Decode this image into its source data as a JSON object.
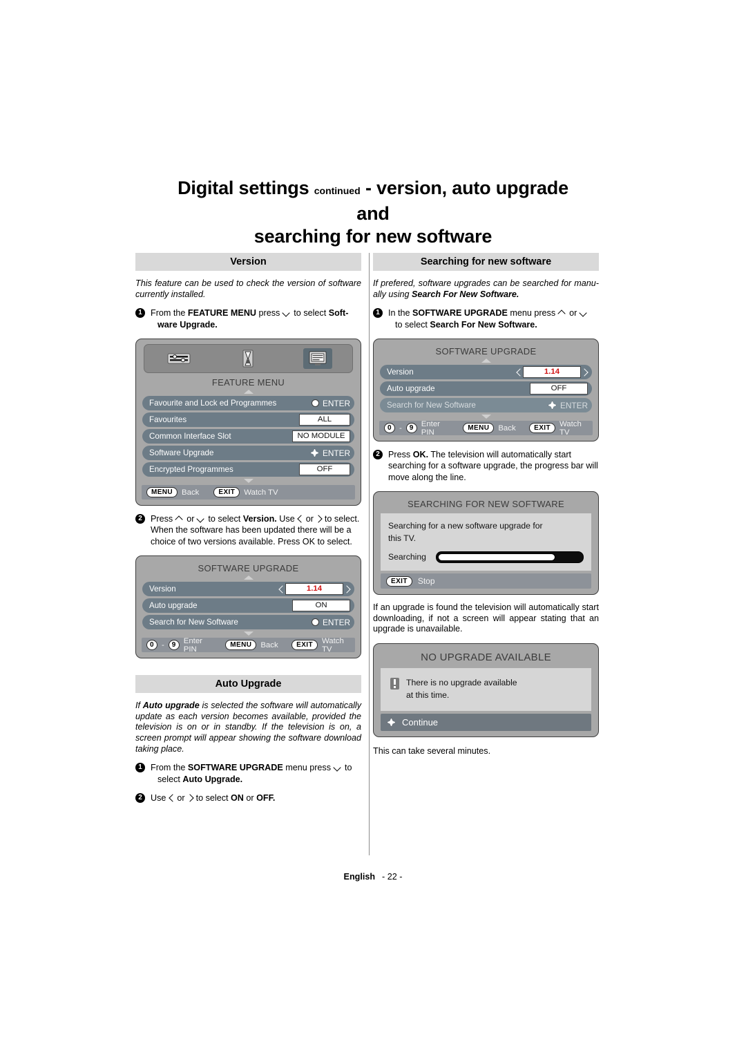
{
  "title": {
    "main_part1": "Digital settings",
    "continued": "continued",
    "main_part2": "- version, auto upgrade and",
    "line2": "searching for new software"
  },
  "left_column": {
    "version_section": {
      "heading": "Version",
      "intro": "This feature can be used to check the version of software currently installed.",
      "step1": {
        "number": "1",
        "text_a": "From the ",
        "bold_a": "FEATURE MENU",
        "text_b": " press ",
        "arrow": "down-arrow",
        "text_c": " to select ",
        "bold_b": "Soft-",
        "line2": "ware Upgrade."
      },
      "feature_menu_screen": {
        "title": "FEATURE MENU",
        "icons": [
          "settings-sliders-icon",
          "hourglass-icon",
          "tv-screen-icon"
        ],
        "selected_icon_index": 2,
        "rows": [
          {
            "label": "Favourite and Lock  ed Programmes",
            "value": "ENTER",
            "type": "enter"
          },
          {
            "label": "Favourites",
            "value": "ALL",
            "type": "value"
          },
          {
            "label": "Common Interface Slot",
            "value": "NO MODULE",
            "type": "value"
          },
          {
            "label": "Software Upgrade",
            "value": "ENTER",
            "type": "enter",
            "selected": true
          },
          {
            "label": "Encrypted Programmes",
            "value": "OFF",
            "type": "value"
          }
        ],
        "bottom_bar": [
          {
            "key": "MENU",
            "label": "Back"
          },
          {
            "key": "EXIT",
            "label": "Watch TV"
          }
        ]
      },
      "step2": {
        "number": "2",
        "text_a": "Press ",
        "text_b": " or ",
        "text_c": " to select ",
        "bold_a": "Version.",
        "text_d": " Use ",
        "text_e": " or ",
        "text_f": " to select. When the software has been updated there will be a choice of two versions available. Press OK to select."
      },
      "software_upgrade_screen": {
        "title": "SOFTWARE UPGRADE",
        "rows": [
          {
            "label": "Version",
            "value": "1.14",
            "type": "spinner"
          },
          {
            "label": "Auto upgrade",
            "value": "ON",
            "type": "value"
          },
          {
            "label": "Search for New Software",
            "value": "ENTER",
            "type": "enter"
          }
        ],
        "bottom_bar": [
          {
            "key": "0",
            "key2": "9",
            "label": "Enter PIN"
          },
          {
            "key": "MENU",
            "label": "Back"
          },
          {
            "key": "EXIT",
            "label": "Watch TV"
          }
        ]
      }
    },
    "auto_upgrade_section": {
      "heading": "Auto Upgrade",
      "intro_bold": "Auto upgrade",
      "intro_a": "If ",
      "intro_b": " is selected the software will automatically update as each version becomes available, provided the television is on or in standby.  If the television is on, a screen prompt will appear showing the software download taking place.",
      "step1": {
        "number": "1",
        "text_a": "From the ",
        "bold_a": "SOFTWARE UPGRADE",
        "text_b": " menu press ",
        "text_c": " to",
        "line2_a": "select ",
        "line2_bold": "Auto Upgrade."
      },
      "step2": {
        "number": "2",
        "text_a": "Use ",
        "text_b": " or ",
        "text_c": " to select ",
        "bold_a": "ON",
        "text_d": " or ",
        "bold_b": "OFF."
      }
    }
  },
  "right_column": {
    "searching_section": {
      "heading": "Searching for new software",
      "intro_a": "If prefered, software upgrades can be searched for manu-ally using ",
      "intro_bold": "Search For New Software.",
      "step1": {
        "number": "1",
        "text_a": "In the ",
        "bold_a": "SOFTWARE UPGRADE",
        "text_b": " menu press ",
        "text_c": " or ",
        "line2_a": "to select ",
        "line2_bold": "Search For New Software."
      },
      "software_upgrade_screen": {
        "title": "SOFTWARE UPGRADE",
        "rows": [
          {
            "label": "Version",
            "value": "1.14",
            "type": "spinner"
          },
          {
            "label": "Auto upgrade",
            "value": "OFF",
            "type": "value"
          },
          {
            "label": "Search for New Software",
            "value": "ENTER",
            "type": "enter",
            "selected": true
          }
        ],
        "bottom_bar": [
          {
            "key": "0",
            "key2": "9",
            "label": "Enter PIN"
          },
          {
            "key": "MENU",
            "label": "Back"
          },
          {
            "key": "EXIT",
            "label": "Watch TV"
          }
        ]
      },
      "step2": {
        "number": "2",
        "text_a": "Press ",
        "bold_a": "OK.",
        "text_b": " The television will automatically start searching for a software upgrade, the progress bar will move along the line."
      },
      "searching_screen": {
        "title": "SEARCHING FOR NEW SOFTWARE",
        "message_line1": "Searching for a new software upgrade for",
        "message_line2": "this TV.",
        "status_label": "Searching",
        "progress_percent": 80,
        "bottom_key": "EXIT",
        "bottom_label": "Stop"
      },
      "found_text": "If an upgrade is found the television will automatically start downloading, if not a screen  will appear stating that an upgrade is unavailable.",
      "no_upgrade_screen": {
        "title": "NO UPGRADE AVAILABLE",
        "warning_icon": "exclamation-icon",
        "message_line1": "There is no upgrade available",
        "message_line2": "at this time.",
        "continue_label": "Continue"
      },
      "closing_text": "This can take several minutes."
    }
  },
  "footer": {
    "language": "English",
    "page": "- 22 -"
  }
}
